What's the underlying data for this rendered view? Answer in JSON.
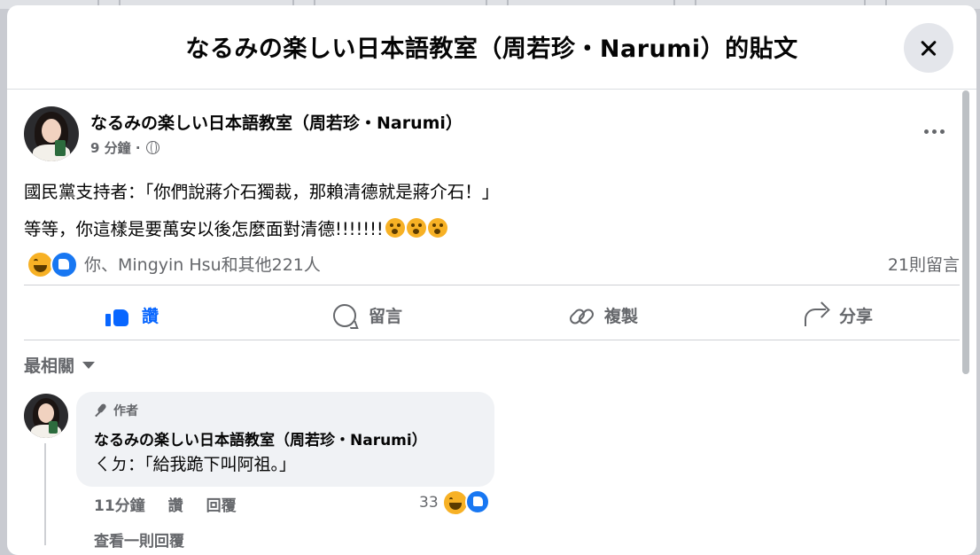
{
  "modal": {
    "title": "なるみの楽しい日本語教室（周若珍・Narumi）的貼文"
  },
  "post": {
    "author": "なるみの楽しい日本語教室（周若珍・Narumi）",
    "time": "9 分鐘 ·",
    "privacy_icon": "globe-icon",
    "lines": [
      "國民黨支持者：「你們說蔣介石獨裁，那賴清德就是蔣介石！」",
      "等等，你這樣是要萬安以後怎麼面對清德!!!!!!!"
    ],
    "reaction_names": "你、Mingyin Hsu和其他221人",
    "comment_count": "21則留言"
  },
  "actions": {
    "like": "讚",
    "comment": "留言",
    "copy": "複製",
    "share": "分享"
  },
  "sort_label": "最相關",
  "comment": {
    "author_tag": "作者",
    "author": "なるみの楽しい日本語教室（周若珍・Narumi）",
    "text": "ㄑㄉ：「給我跪下叫阿祖。」",
    "time": "11分鐘",
    "like": "讚",
    "reply": "回覆",
    "reaction_count": "33",
    "next_line": "查看一則回覆"
  },
  "colors": {
    "accent": "#0866ff",
    "secondary_text": "#65676b",
    "bubble_bg": "#f0f2f5"
  }
}
